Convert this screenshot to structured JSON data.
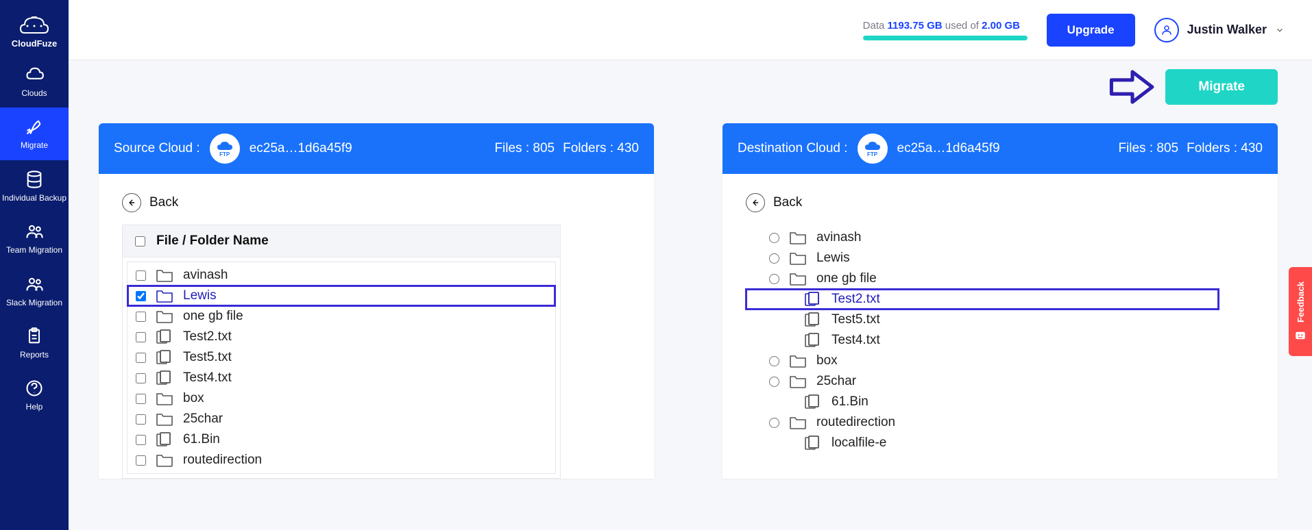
{
  "app": {
    "name": "CloudFuze"
  },
  "sidebar": {
    "items": [
      {
        "label": "Clouds",
        "icon": "cloud"
      },
      {
        "label": "Migrate",
        "icon": "rocket",
        "active": true
      },
      {
        "label": "Individual Backup",
        "icon": "database"
      },
      {
        "label": "Team Migration",
        "icon": "team"
      },
      {
        "label": "Slack Migration",
        "icon": "team-slack"
      },
      {
        "label": "Reports",
        "icon": "clipboard"
      },
      {
        "label": "Help",
        "icon": "help"
      }
    ]
  },
  "header": {
    "data_prefix": "Data",
    "used": "1193.75 GB",
    "used_of": "used of",
    "total": "2.00 GB",
    "upgrade_label": "Upgrade",
    "user_name": "Justin Walker"
  },
  "actions": {
    "migrate_label": "Migrate"
  },
  "source": {
    "title": "Source Cloud :",
    "cloud_id": "ec25a…1d6a45f9",
    "files_label": "Files : 805",
    "folders_label": "Folders : 430",
    "back_label": "Back",
    "list_title": "File / Folder Name",
    "items": [
      {
        "name": "avinash",
        "type": "folder",
        "checked": false
      },
      {
        "name": "Lewis",
        "type": "folder",
        "checked": true,
        "highlighted": true
      },
      {
        "name": "one gb file",
        "type": "folder",
        "checked": false
      },
      {
        "name": "Test2.txt",
        "type": "file",
        "checked": false
      },
      {
        "name": "Test5.txt",
        "type": "file",
        "checked": false
      },
      {
        "name": "Test4.txt",
        "type": "file",
        "checked": false
      },
      {
        "name": "box",
        "type": "folder",
        "checked": false
      },
      {
        "name": "25char",
        "type": "folder",
        "checked": false
      },
      {
        "name": "61.Bin",
        "type": "file",
        "checked": false
      },
      {
        "name": "routedirection",
        "type": "folder",
        "checked": false
      }
    ]
  },
  "destination": {
    "title": "Destination Cloud :",
    "cloud_id": "ec25a…1d6a45f9",
    "files_label": "Files : 805",
    "folders_label": "Folders : 430",
    "back_label": "Back",
    "items": [
      {
        "name": "avinash",
        "type": "folder"
      },
      {
        "name": "Lewis",
        "type": "folder"
      },
      {
        "name": "one gb file",
        "type": "folder"
      },
      {
        "name": "Test2.txt",
        "type": "file",
        "indent": true,
        "highlighted": true
      },
      {
        "name": "Test5.txt",
        "type": "file",
        "indent": true
      },
      {
        "name": "Test4.txt",
        "type": "file",
        "indent": true
      },
      {
        "name": "box",
        "type": "folder"
      },
      {
        "name": "25char",
        "type": "folder"
      },
      {
        "name": "61.Bin",
        "type": "file",
        "indent": true
      },
      {
        "name": "routedirection",
        "type": "folder"
      },
      {
        "name": "localfile-e",
        "type": "file",
        "indent": true
      }
    ]
  },
  "feedback": {
    "label": "Feedback"
  }
}
